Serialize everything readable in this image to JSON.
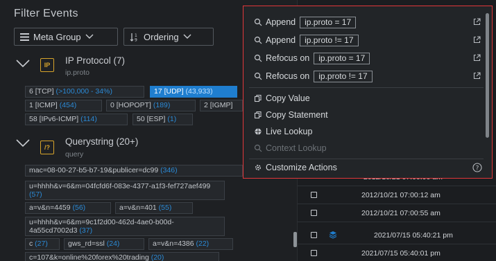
{
  "panel": {
    "title": "Filter Events",
    "meta_group_label": "Meta Group",
    "ordering_label": "Ordering"
  },
  "groups": [
    {
      "icon_text": "IP",
      "name": "IP Protocol (7)",
      "key": "ip.proto",
      "chips": [
        {
          "label": "6 [TCP]",
          "count": "(>100,000 - 34%)"
        },
        {
          "label": "17 [UDP]",
          "count": "(43,933)",
          "selected": true
        },
        {
          "label": "1 [ICMP]",
          "count": "(454)"
        },
        {
          "label": "0 [HOPOPT]",
          "count": "(189)"
        },
        {
          "label": "2 [IGMP]",
          "count": ""
        },
        {
          "label": "58 [IPv6-ICMP]",
          "count": "(114)"
        },
        {
          "label": "50 [ESP]",
          "count": "(1)"
        }
      ]
    },
    {
      "icon_text": "/?",
      "name": "Querystring (20+)",
      "key": "query",
      "chips": [
        {
          "label": "mac=08-00-27-b5-b7-19&publicer=dc99",
          "count": "(346)"
        },
        {
          "label": "u=hhhh&v=6&m=04fcfd6f-083e-4377-a1f3-fef727aef499",
          "count": "(57)"
        },
        {
          "label": "a=v&n=4459",
          "count": "(56)"
        },
        {
          "label": "a=v&n=401",
          "count": "(55)"
        },
        {
          "label": "u=hhhh&v=6&m=9c1f2d00-462d-4ae0-b00d-4a55cd7002d3",
          "count": "(37)"
        },
        {
          "label": "c",
          "count": "(27)"
        },
        {
          "label": "gws_rd=ssl",
          "count": "(24)"
        },
        {
          "label": "a=v&n=4386",
          "count": "(22)"
        },
        {
          "label": "c=107&k=online%20forex%20trading",
          "count": "(20)"
        }
      ]
    }
  ],
  "events": [
    {
      "time": "2012/10/21 07:00:00 am"
    },
    {
      "time": "2012/10/21 07:00:12 am"
    },
    {
      "time": "2012/10/21 07:00:55 am"
    },
    {
      "time": "2021/07/15 05:40:21 pm"
    },
    {
      "time": "2021/07/15 05:40:01 pm"
    }
  ],
  "menu": {
    "items": [
      {
        "action": "Append",
        "value": "ip.proto = 17"
      },
      {
        "action": "Append",
        "value": "ip.proto != 17"
      },
      {
        "action": "Refocus on",
        "value": "ip.proto = 17"
      },
      {
        "action": "Refocus on",
        "value": "ip.proto != 17"
      }
    ],
    "copy_value": "Copy Value",
    "copy_statement": "Copy Statement",
    "live_lookup": "Live Lookup",
    "context_lookup": "Context Lookup",
    "customize_actions": "Customize Actions"
  },
  "colors": {
    "accent": "#1f7ecf",
    "count_text": "#2b8ad6",
    "group_icon": "#d8a52b",
    "menu_border": "#e2373a"
  }
}
